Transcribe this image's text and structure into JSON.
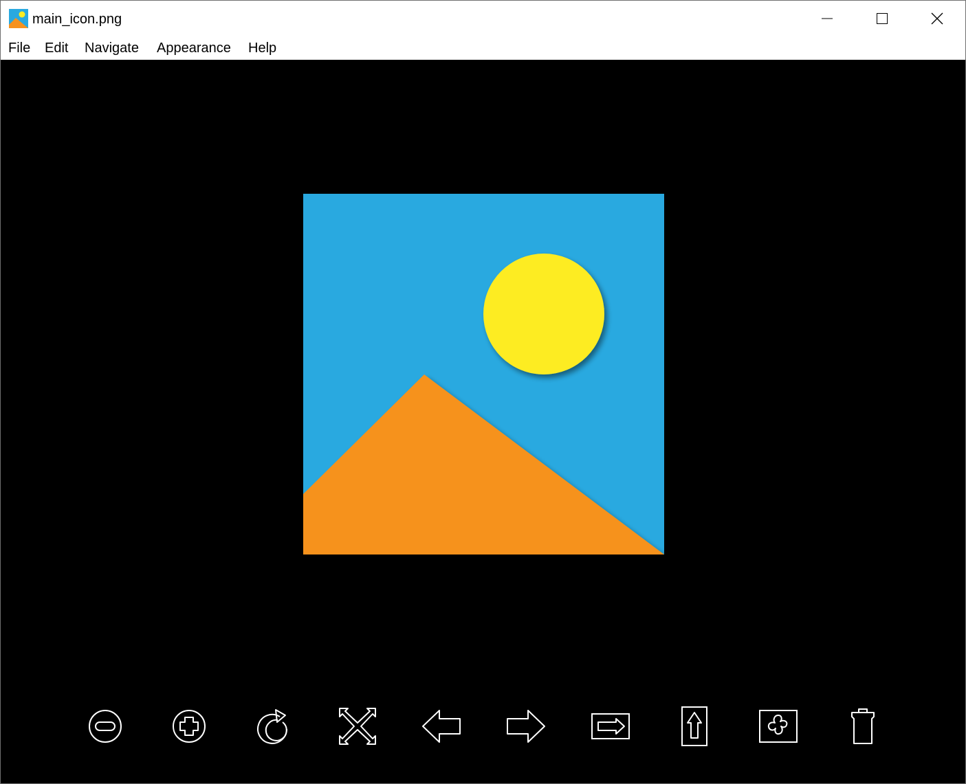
{
  "window": {
    "title": "main_icon.png",
    "controls": {
      "minimize": "minimize-icon",
      "maximize": "maximize-icon",
      "close": "close-icon"
    }
  },
  "menu": {
    "items": [
      "File",
      "Edit",
      "Navigate",
      "Appearance",
      "Help"
    ]
  },
  "image": {
    "description_icon": "landscape-image",
    "colors": {
      "sky": "#29a9e0",
      "sun": "#fdec22",
      "mountain": "#f6921e",
      "background": "#000000"
    }
  },
  "toolbar": {
    "buttons": [
      "zoom-out-icon",
      "zoom-in-icon",
      "rotate-icon",
      "fit-to-window-icon",
      "previous-arrow-icon",
      "next-arrow-icon",
      "slideshow-icon",
      "open-folder-up-icon",
      "set-wallpaper-icon",
      "delete-icon"
    ]
  }
}
